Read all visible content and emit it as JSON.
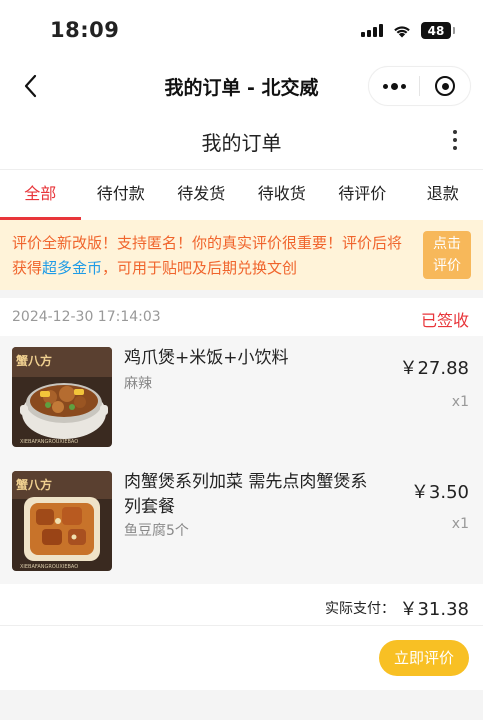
{
  "status_bar": {
    "time": "18:09",
    "battery": "48"
  },
  "nav": {
    "title": "我的订单 - 北交威"
  },
  "header": {
    "title": "我的订单"
  },
  "tabs": [
    {
      "label": "全部",
      "active": true
    },
    {
      "label": "待付款"
    },
    {
      "label": "待发货"
    },
    {
      "label": "待收货"
    },
    {
      "label": "待评价"
    },
    {
      "label": "退款"
    }
  ],
  "notice": {
    "text_before": "评价全新改版！支持匿名！你的真实评价很重要！评价后将获得",
    "highlight": "超多金币",
    "text_after": "，可用于贴吧及后期兑换文创",
    "button_line1": "点击",
    "button_line2": "评价"
  },
  "order": {
    "date": "2024-12-30 17:14:03",
    "status": "已签收",
    "items": [
      {
        "name": "鸡爪煲+米饭+小饮料",
        "spec": "麻辣",
        "price": "￥27.88",
        "qty": "x1",
        "image_icon": "food-photo-chicken-feet-pot",
        "brand": "蟹八方",
        "brand_sub": "XIEBAFANGROUXIEBAO"
      },
      {
        "name": "肉蟹煲系列加菜 需先点肉蟹煲系列套餐",
        "spec": "鱼豆腐5个",
        "price": "￥3.50",
        "qty": "x1",
        "image_icon": "food-photo-fish-tofu-box",
        "brand": "蟹八方",
        "brand_sub": "XIEBAFANGROUXIEBAO"
      }
    ],
    "total_label": "实际支付：",
    "total_value": "￥31.38",
    "rate_button": "立即评价"
  },
  "colors": {
    "accent_red": "#e8353a",
    "notice_bg": "#fff3d9",
    "notice_text": "#f0642c",
    "highlight_blue": "#1e9be6",
    "rate_button": "#f8c024"
  }
}
